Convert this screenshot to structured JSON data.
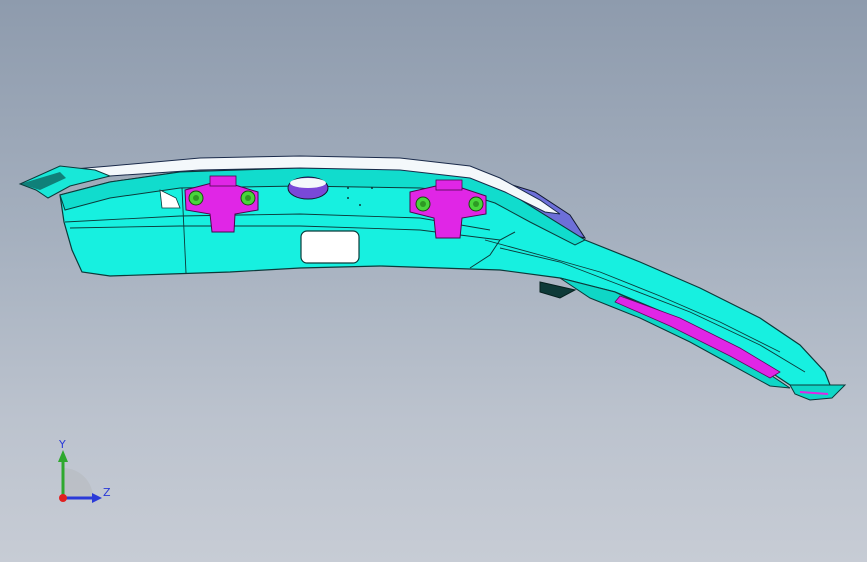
{
  "viewport": {
    "background_top": "#8e9bad",
    "background_bottom": "#c7ccd5"
  },
  "model": {
    "name": "tailgate-spoiler-part",
    "colors": {
      "body": "#17f0e0",
      "body_shade": "#0fd6c6",
      "edge": "#0b3a3a",
      "brackets": "#e026e6",
      "bolts": "#49d63c",
      "trim_top": "#ffffff",
      "hidden_face": "#6b3fd6"
    }
  },
  "triad": {
    "y_label": "Y",
    "z_label": "Z",
    "y_color": "#2ea82e",
    "z_color": "#2a3ad8",
    "x_color": "#e02020"
  }
}
